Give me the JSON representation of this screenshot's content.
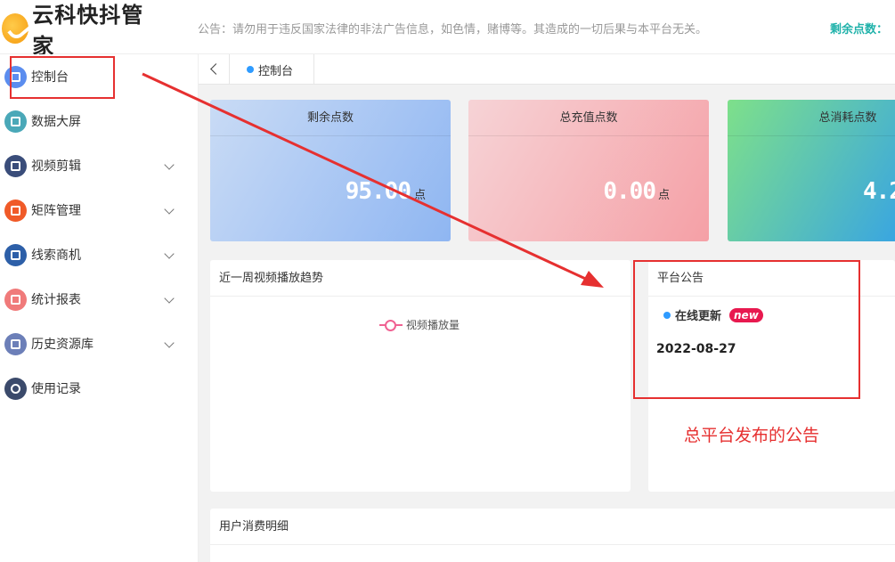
{
  "header": {
    "logo_text": "云科快抖管家",
    "notice": "公告：请勿用于违反国家法律的非法广告信息，如色情，赌博等。其造成的一切后果与本平台无关。",
    "points_label": "剩余点数："
  },
  "sidebar": {
    "items": [
      {
        "label": "控制台",
        "icon": "dashboard-icon",
        "color": "#5b8def",
        "expandable": false
      },
      {
        "label": "数据大屏",
        "icon": "screen-icon",
        "color": "#4aa8b8",
        "expandable": false
      },
      {
        "label": "视频剪辑",
        "icon": "video-edit-icon",
        "color": "#3a4d7a",
        "expandable": true
      },
      {
        "label": "矩阵管理",
        "icon": "matrix-icon",
        "color": "#f05a28",
        "expandable": true
      },
      {
        "label": "线索商机",
        "icon": "leads-icon",
        "color": "#2d5fa8",
        "expandable": true
      },
      {
        "label": "统计报表",
        "icon": "report-icon",
        "color": "#f07a7a",
        "expandable": true
      },
      {
        "label": "历史资源库",
        "icon": "library-icon",
        "color": "#6c7fb8",
        "expandable": true
      },
      {
        "label": "使用记录",
        "icon": "clock-icon",
        "color": "#3b4a6b",
        "expandable": false
      }
    ]
  },
  "tabs": {
    "active_label": "控制台"
  },
  "cards": [
    {
      "title": "剩余点数",
      "value": "95.00",
      "unit": "点",
      "gradient": [
        "#c9dbf5",
        "#8fb6f2"
      ]
    },
    {
      "title": "总充值点数",
      "value": "0.00",
      "unit": "点",
      "gradient": [
        "#f6d3d6",
        "#f5a0a6"
      ]
    },
    {
      "title": "总消耗点数",
      "value": "4.2",
      "unit": "",
      "gradient": [
        "#7ee08a",
        "#3aa6e0"
      ]
    }
  ],
  "trend_panel": {
    "title": "近一周视频播放趋势",
    "legend": "视频播放量"
  },
  "announcement_panel": {
    "title": "平台公告",
    "item_label": "在线更新",
    "badge": "new",
    "date": "2022-08-27"
  },
  "annotation": {
    "label": "总平台发布的公告",
    "color": "#e63030"
  },
  "detail_panel": {
    "title": "用户消费明细"
  }
}
